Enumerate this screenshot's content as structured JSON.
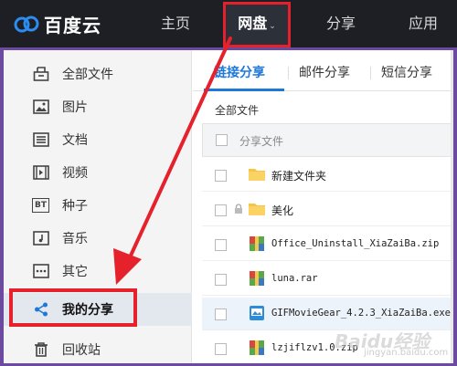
{
  "brand": {
    "name": "百度云"
  },
  "nav": {
    "items": [
      {
        "label": "主页"
      },
      {
        "label": "网盘",
        "caret": "⌄"
      },
      {
        "label": "分享"
      },
      {
        "label": "应用"
      }
    ]
  },
  "sidebar": {
    "items": [
      {
        "label": "全部文件",
        "icon": "all-files-icon"
      },
      {
        "label": "图片",
        "icon": "image-icon"
      },
      {
        "label": "文档",
        "icon": "document-icon"
      },
      {
        "label": "视频",
        "icon": "video-icon"
      },
      {
        "label": "种子",
        "icon": "bt-torrent-icon",
        "badge": "BT"
      },
      {
        "label": "音乐",
        "icon": "music-icon"
      },
      {
        "label": "其它",
        "icon": "more-icon"
      },
      {
        "label": "我的分享",
        "icon": "share-icon",
        "active": true
      },
      {
        "label": "回收站",
        "icon": "trash-icon"
      }
    ]
  },
  "tabs": [
    {
      "label": "链接分享",
      "active": true
    },
    {
      "label": "邮件分享"
    },
    {
      "label": "短信分享"
    }
  ],
  "breadcrumb": "全部文件",
  "table": {
    "header": "分享文件",
    "rows": [
      {
        "name": "新建文件夹",
        "type": "folder",
        "locked": false
      },
      {
        "name": "美化",
        "type": "folder",
        "locked": true
      },
      {
        "name": "Office_Uninstall_XiaZaiBa.zip",
        "type": "archive"
      },
      {
        "name": "luna.rar",
        "type": "archive"
      },
      {
        "name": "GIFMovieGear_4.2.3_XiaZaiBa.exe",
        "type": "exe",
        "highlighted": true
      },
      {
        "name": "lzjiflzv1.0.zip",
        "type": "archive"
      }
    ]
  },
  "watermark": {
    "main": "Baidu经验",
    "sub": "jingyan.baidu.com"
  },
  "colors": {
    "topbar": "#1d1f24",
    "accent_blue": "#1e78d9",
    "annotation_red": "#e5212b",
    "frame_purple": "#6b4aa0",
    "folder_yellow": "#f7c443"
  }
}
